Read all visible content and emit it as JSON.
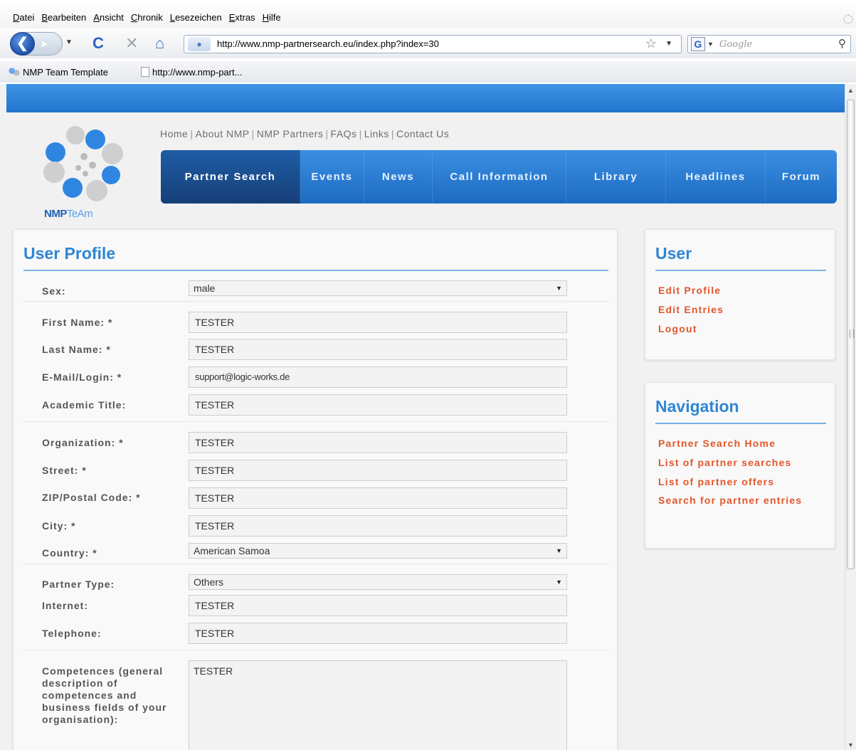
{
  "browser": {
    "menu": [
      "Datei",
      "Bearbeiten",
      "Ansicht",
      "Chronik",
      "Lesezeichen",
      "Extras",
      "Hilfe"
    ],
    "url": "http://www.nmp-partnersearch.eu/index.php?index=30",
    "search_placeholder": "Google",
    "bookmarks": [
      "NMP Team Template",
      "http://www.nmp-part..."
    ]
  },
  "site": {
    "logo_text_dark": "NMP",
    "logo_text_light": "TeAm",
    "top_links": [
      "Home",
      "About NMP",
      "NMP Partners",
      "FAQs",
      "Links",
      "Contact Us"
    ],
    "nav": [
      {
        "label": "Partner Search",
        "active": true
      },
      {
        "label": "Events"
      },
      {
        "label": "News"
      },
      {
        "label": "Call Information"
      },
      {
        "label": "Library"
      },
      {
        "label": "Headlines"
      },
      {
        "label": "Forum"
      }
    ]
  },
  "profile": {
    "title": "User Profile",
    "sex_label": "Sex:",
    "sex_value": "male",
    "first_name_label": "First Name: *",
    "first_name": "TESTER",
    "last_name_label": "Last Name: *",
    "last_name": "TESTER",
    "email_label": "E-Mail/Login: *",
    "email": "support@logic-works.de",
    "academic_title_label": "Academic Title:",
    "academic_title": "TESTER",
    "organization_label": "Organization: *",
    "organization": "TESTER",
    "street_label": "Street: *",
    "street": "TESTER",
    "zip_label": "ZIP/Postal Code: *",
    "zip": "TESTER",
    "city_label": "City: *",
    "city": "TESTER",
    "country_label": "Country: *",
    "country": "American Samoa",
    "partner_type_label": "Partner Type:",
    "partner_type": "Others",
    "internet_label": "Internet:",
    "internet": "TESTER",
    "telephone_label": "Telephone:",
    "telephone": "TESTER",
    "competences_label": "Competences (general description of competences and business fields of your organisation):",
    "competences": "TESTER"
  },
  "user_box": {
    "title": "User",
    "links": [
      "Edit Profile",
      "Edit Entries",
      "Logout"
    ]
  },
  "navigation_box": {
    "title": "Navigation",
    "links": [
      "Partner Search Home",
      "List of partner searches",
      "List of partner offers",
      "Search for partner entries"
    ]
  },
  "colors": {
    "brand_blue": "#2275cc",
    "link_orange": "#e2562a",
    "title_blue": "#2f86d4"
  }
}
